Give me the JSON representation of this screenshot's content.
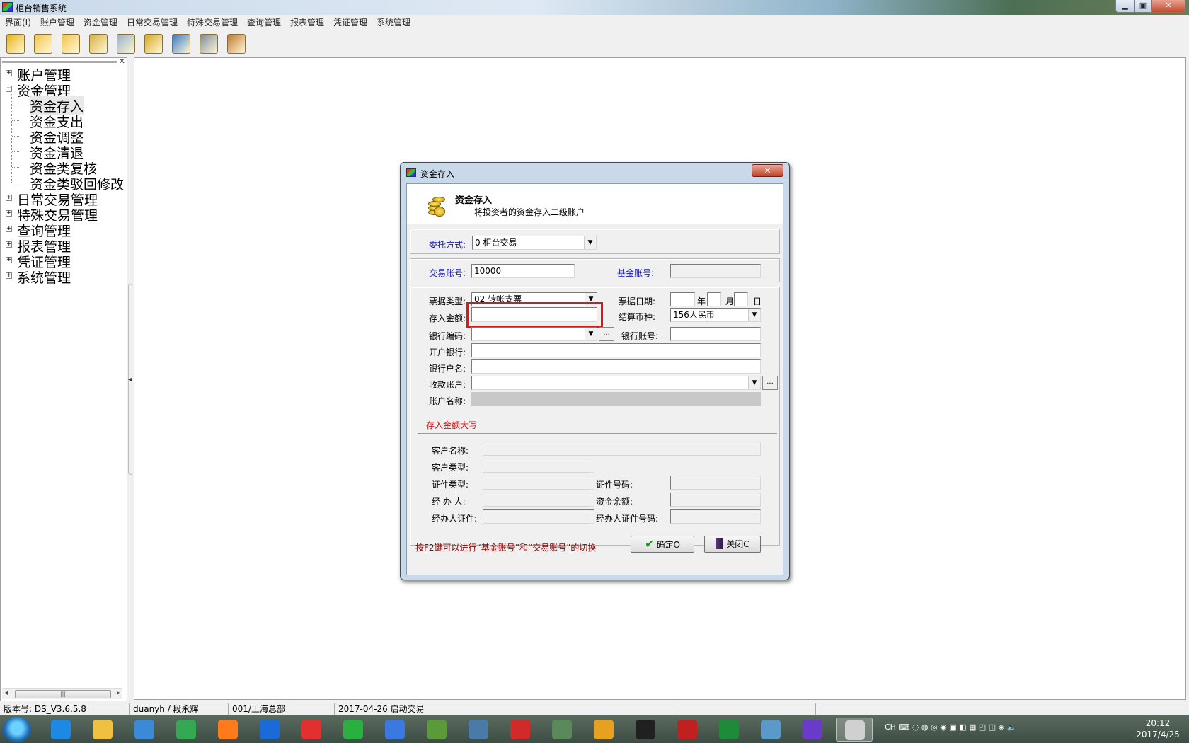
{
  "app": {
    "title": "柜台销售系统",
    "win_min": "▁",
    "win_max": "▣",
    "win_close": "✕"
  },
  "menu": [
    "界面(I)",
    "账户管理",
    "资金管理",
    "日常交易管理",
    "特殊交易管理",
    "查询管理",
    "报表管理",
    "凭证管理",
    "系统管理"
  ],
  "toolbar": {
    "icons": [
      "user-icon",
      "folder-icon",
      "folder-edit-icon",
      "search-user-icon",
      "magnifier-icon",
      "gear-search-icon",
      "report-chart-icon",
      "printer-icon",
      "tools-icon"
    ],
    "colors": [
      "#e6b417",
      "#f2c64a",
      "#f2c64a",
      "#d8b040",
      "#9ab0c8",
      "#d8a820",
      "#3a7ac8",
      "#7a8a9a",
      "#c07a30"
    ]
  },
  "tree": {
    "close": "✕",
    "nodes": [
      {
        "label": "账户管理",
        "exp": "+"
      },
      {
        "label": "资金管理",
        "exp": "−"
      },
      {
        "label": "资金存入",
        "child": true,
        "selected": true
      },
      {
        "label": "资金支出",
        "child": true
      },
      {
        "label": "资金调整",
        "child": true
      },
      {
        "label": "资金清退",
        "child": true
      },
      {
        "label": "资金类复核",
        "child": true
      },
      {
        "label": "资金类驳回修改",
        "child": true
      },
      {
        "label": "日常交易管理",
        "exp": "+"
      },
      {
        "label": "特殊交易管理",
        "exp": "+"
      },
      {
        "label": "查询管理",
        "exp": "+"
      },
      {
        "label": "报表管理",
        "exp": "+"
      },
      {
        "label": "凭证管理",
        "exp": "+"
      },
      {
        "label": "系统管理",
        "exp": "+"
      }
    ],
    "scroll_grip": "|||"
  },
  "splitter_arrow": "◂",
  "status": {
    "version": "版本号: DS_V3.6.5.8",
    "user": "duanyh / 段永辉",
    "org": "001/上海总部",
    "date": "2017-04-26 启动交易"
  },
  "taskbar": {
    "colors": [
      "#1e88e5",
      "#f0c040",
      "#3a8ad8",
      "#34a853",
      "#ff7a1a",
      "#1a6ad8",
      "#e03030",
      "#2ab040",
      "#3a7ae0",
      "#5a9a3a",
      "#4a7aa8",
      "#d02a2a",
      "#5a8a5a",
      "#e8a020",
      "#202020",
      "#c02020",
      "#1e8a3a",
      "#5a9ac8",
      "#6a3ac8",
      "#d0d0d0"
    ],
    "icons": [
      "ie-icon",
      "explorer-icon",
      "media-icon",
      "chrome-icon",
      "firefox-icon",
      "browser-icon",
      "netease-icon",
      "wechat-icon",
      "baidu-icon",
      "notepad-icon",
      "remote-icon",
      "sogou-icon",
      "pc-icon",
      "contacts-icon",
      "cmd-icon",
      "pen-icon",
      "excel-icon",
      "paint-icon",
      "visual-studio-icon",
      "app-icon"
    ],
    "tray": "CH ⌨ ◌ ◍ ◎ ◉ ▣ ◧ ▦ ◰ ◫ ◈ 🔈",
    "time": "20:12",
    "date": "2017/4/25"
  },
  "dialog": {
    "title": "资金存入",
    "close": "✕",
    "header_title": "资金存入",
    "header_sub": "将投资者的资金存入二级账户",
    "entrust_label": "委托方式:",
    "entrust_value": "0   柜台交易",
    "trade_acct_label": "交易账号:",
    "trade_acct_value": "10000",
    "fund_acct_label": "基金账号:",
    "bill_type_label": "票据类型:",
    "bill_type_value": "02  转帐支票",
    "bill_date_label": "票据日期:",
    "year": "年",
    "month": "月",
    "day": "日",
    "amount_label": "存入金额:",
    "amount_value": "",
    "currency_label": "结算币种:",
    "currency_value": "156人民币",
    "bank_code_label": "银行编码:",
    "bank_acct_label": "银行账号:",
    "open_bank_label": "开户银行:",
    "bank_holder_label": "银行户名:",
    "receive_acct_label": "收款账户:",
    "acct_name_label": "账户名称:",
    "amount_caps_label": "存入金额大写",
    "cust_name_label": "客户名称:",
    "cust_type_label": "客户类型:",
    "id_type_label": "证件类型:",
    "id_no_label": "证件号码:",
    "agent_label": "经 办 人:",
    "balance_label": "资金余额:",
    "agent_id_label": "经办人证件:",
    "agent_id_no_label": "经办人证件号码:",
    "note": "按F2键可以进行“基金账号”和“交易账号”的切换",
    "ok_label": "确定O",
    "close_label": "关闭C",
    "dropdown_arrow": "▼",
    "ellipsis": "..."
  }
}
